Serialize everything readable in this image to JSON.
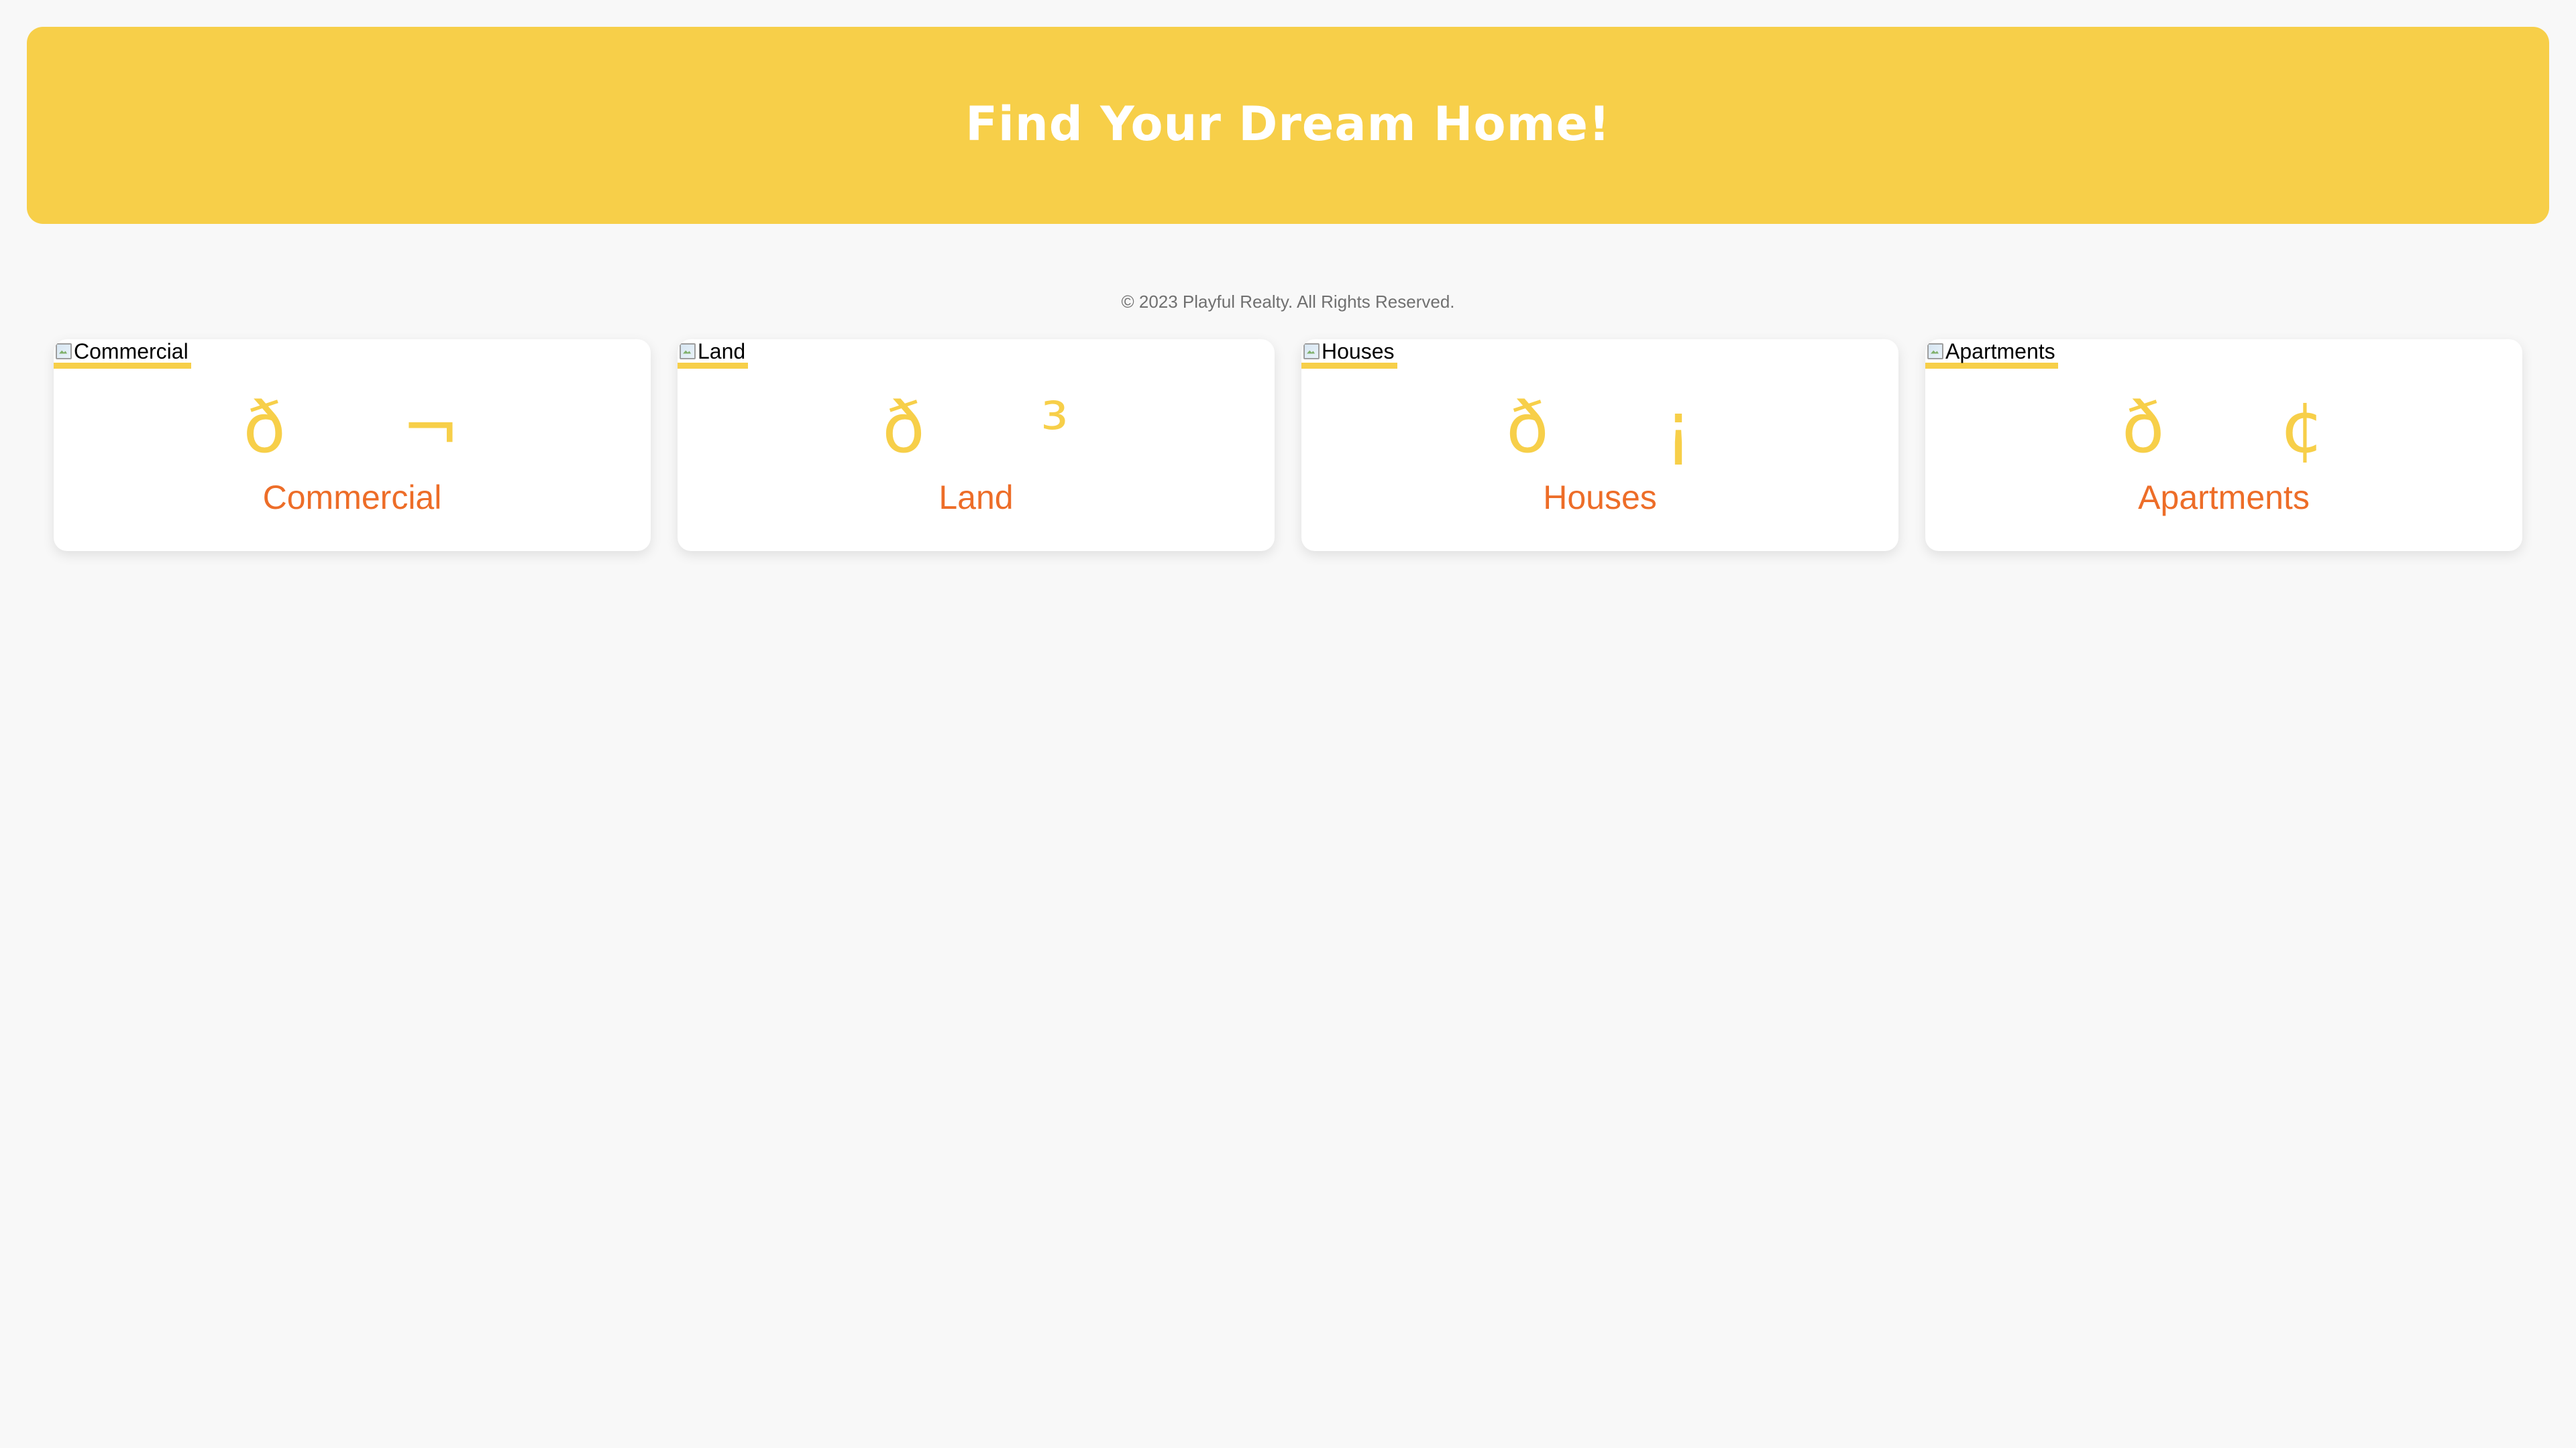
{
  "hero": {
    "title": "Find Your Dream Home!"
  },
  "footer": {
    "copyright": "© 2023 Playful Realty. All Rights Reserved."
  },
  "categories": [
    {
      "alt": "Commercial",
      "icon": "ð¬",
      "label": "Commercial",
      "icon_name": "office-building-icon"
    },
    {
      "alt": "Land",
      "icon": "ð³",
      "label": "Land",
      "icon_name": "tree-icon"
    },
    {
      "alt": "Houses",
      "icon": "ð¡",
      "label": "Houses",
      "icon_name": "house-icon"
    },
    {
      "alt": "Apartments",
      "icon": "ð¢",
      "label": "Apartments",
      "icon_name": "apartment-building-icon"
    }
  ],
  "colors": {
    "hero_background": "#f7cf49",
    "icon": "#f7cf49",
    "label": "#ed6d28",
    "page_background": "#f8f8f8"
  }
}
